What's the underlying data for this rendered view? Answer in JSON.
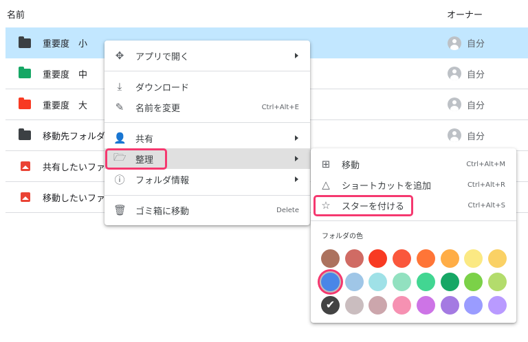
{
  "header": {
    "name": "名前",
    "owner": "オーナー"
  },
  "rows": [
    {
      "name": "重要度　小",
      "icon": "folder",
      "color": "#3c4043",
      "owner": "自分",
      "selected": true
    },
    {
      "name": "重要度　中",
      "icon": "folder",
      "color": "#16a765",
      "owner": "自分"
    },
    {
      "name": "重要度　大",
      "icon": "folder",
      "color": "#f83a22",
      "owner": "自分"
    },
    {
      "name": "移動先フォルダ",
      "icon": "folder",
      "color": "#3c4043",
      "owner": "自分"
    },
    {
      "name": "共有したいファ",
      "icon": "image",
      "owner": ""
    },
    {
      "name": "移動したいファ",
      "icon": "image",
      "owner": ""
    }
  ],
  "menu": {
    "items": [
      {
        "label": "アプリで開く",
        "icon": "move-icon",
        "submenu": true
      },
      {
        "label": "ダウンロード",
        "icon": "download-icon"
      },
      {
        "label": "名前を変更",
        "icon": "rename-icon",
        "shortcut": "Ctrl+Alt+E"
      },
      {
        "label": "共有",
        "icon": "person-add-icon",
        "submenu": true
      },
      {
        "label": "整理",
        "icon": "folder-open-icon",
        "submenu": true,
        "highlighted": true
      },
      {
        "label": "フォルダ情報",
        "icon": "info-icon",
        "submenu": true
      },
      {
        "label": "ゴミ箱に移動",
        "icon": "trash-icon",
        "shortcut": "Delete"
      }
    ]
  },
  "submenu": {
    "items": [
      {
        "label": "移動",
        "icon": "folder-move-icon",
        "shortcut": "Ctrl+Alt+M"
      },
      {
        "label": "ショートカットを追加",
        "icon": "add-shortcut-icon",
        "shortcut": "Ctrl+Alt+R"
      },
      {
        "label": "スターを付ける",
        "icon": "star-icon",
        "shortcut": "Ctrl+Alt+S"
      }
    ],
    "color_heading": "フォルダの色",
    "colors": [
      "#ac725e",
      "#d06b64",
      "#f83a22",
      "#fa573c",
      "#ff7537",
      "#ffad46",
      "#fbe983",
      "#fad165",
      "#4986e7",
      "#9fc6e7",
      "#9fe1e7",
      "#92e1c0",
      "#42d692",
      "#16a765",
      "#7bd148",
      "#b3dc6c",
      "#434343",
      "#cabdbf",
      "#cca6ac",
      "#f691b2",
      "#cd74e6",
      "#a47ae2",
      "#9a9cff",
      "#b99aff"
    ],
    "current_color": "#434343",
    "highlighted_color": "#4986e7"
  },
  "accent": "#f5386f"
}
